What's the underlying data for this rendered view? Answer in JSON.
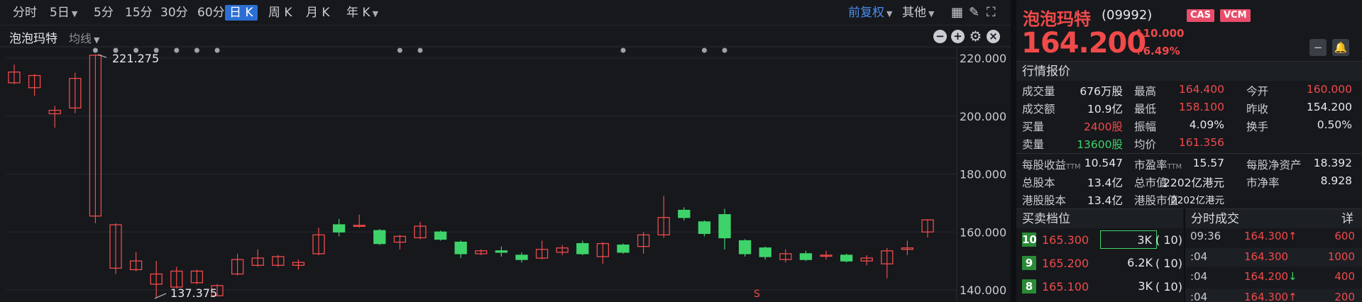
{
  "toolbar": {
    "periods": [
      {
        "label": "分时",
        "active": false,
        "has_menu": false
      },
      {
        "label": "5日",
        "active": false,
        "has_menu": true
      },
      {
        "label": "5分",
        "active": false,
        "has_menu": false
      },
      {
        "label": "15分",
        "active": false,
        "has_menu": false
      },
      {
        "label": "30分",
        "active": false,
        "has_menu": false
      },
      {
        "label": "60分",
        "active": false,
        "has_menu": false
      },
      {
        "label": "日 K",
        "active": true,
        "has_menu": false
      },
      {
        "label": "周 K",
        "active": false,
        "has_menu": false
      },
      {
        "label": "月 K",
        "active": false,
        "has_menu": false
      },
      {
        "label": "年 K",
        "active": false,
        "has_menu": true
      }
    ],
    "adjust_label": "前复权",
    "more_label": "其他",
    "icons": [
      "grid-layout-icon",
      "draw-pen-icon",
      "fullscreen-icon"
    ]
  },
  "chart_header": {
    "title": "泡泡玛特",
    "indicator_label": "均线",
    "controls": [
      "minus-icon",
      "plus-icon",
      "settings-icon",
      "close-icon"
    ]
  },
  "chart_data": {
    "type": "candlestick",
    "y_ticks": [
      "220.000",
      "200.000",
      "180.000",
      "160.000",
      "140.000"
    ],
    "ylim": [
      134,
      224
    ],
    "annotations": [
      {
        "label": "221.275",
        "kind": "high"
      },
      {
        "label": "137.375",
        "kind": "low"
      },
      {
        "label": "S",
        "kind": "marker"
      }
    ],
    "candles": [
      {
        "o": 211.5,
        "c": 215.2,
        "h": 217.8,
        "l": 211.0
      },
      {
        "o": 209.8,
        "c": 214.0,
        "h": 214.5,
        "l": 207.0
      },
      {
        "o": 200.8,
        "c": 202.0,
        "h": 203.5,
        "l": 196.0
      },
      {
        "o": 202.8,
        "c": 213.0,
        "h": 215.0,
        "l": 201.0
      },
      {
        "o": 165.5,
        "c": 221.0,
        "h": 221.3,
        "l": 163.0
      },
      {
        "o": 147.5,
        "c": 162.5,
        "h": 163.0,
        "l": 145.5
      },
      {
        "o": 147.0,
        "c": 150.0,
        "h": 153.0,
        "l": 146.5
      },
      {
        "o": 142.0,
        "c": 145.5,
        "h": 150.0,
        "l": 137.4
      },
      {
        "o": 141.0,
        "c": 146.5,
        "h": 148.0,
        "l": 140.5
      },
      {
        "o": 142.5,
        "c": 146.5,
        "h": 147.0,
        "l": 142.0
      },
      {
        "o": 138.0,
        "c": 141.5,
        "h": 142.0,
        "l": 137.8
      },
      {
        "o": 145.5,
        "c": 150.5,
        "h": 152.5,
        "l": 145.0
      },
      {
        "o": 148.5,
        "c": 151.0,
        "h": 154.0,
        "l": 148.0
      },
      {
        "o": 148.5,
        "c": 151.5,
        "h": 152.0,
        "l": 148.0
      },
      {
        "o": 148.5,
        "c": 149.5,
        "h": 150.5,
        "l": 147.0
      },
      {
        "o": 152.5,
        "c": 159.0,
        "h": 161.5,
        "l": 152.0
      },
      {
        "o": 162.5,
        "c": 160.0,
        "h": 164.5,
        "l": 158.5
      },
      {
        "o": 162.0,
        "c": 162.3,
        "h": 166.0,
        "l": 161.5
      },
      {
        "o": 160.5,
        "c": 156.0,
        "h": 161.0,
        "l": 155.5
      },
      {
        "o": 156.5,
        "c": 158.5,
        "h": 159.0,
        "l": 154.0
      },
      {
        "o": 158.0,
        "c": 162.0,
        "h": 163.5,
        "l": 157.5
      },
      {
        "o": 160.0,
        "c": 157.5,
        "h": 160.5,
        "l": 157.0
      },
      {
        "o": 156.5,
        "c": 152.5,
        "h": 157.0,
        "l": 151.0
      },
      {
        "o": 152.5,
        "c": 153.5,
        "h": 154.0,
        "l": 152.0
      },
      {
        "o": 153.5,
        "c": 153.0,
        "h": 155.0,
        "l": 151.5
      },
      {
        "o": 152.0,
        "c": 150.5,
        "h": 153.0,
        "l": 149.5
      },
      {
        "o": 151.0,
        "c": 154.0,
        "h": 157.0,
        "l": 150.5
      },
      {
        "o": 153.0,
        "c": 154.5,
        "h": 155.5,
        "l": 152.0
      },
      {
        "o": 156.0,
        "c": 152.5,
        "h": 157.0,
        "l": 152.0
      },
      {
        "o": 151.5,
        "c": 156.0,
        "h": 156.5,
        "l": 149.0
      },
      {
        "o": 155.5,
        "c": 153.0,
        "h": 156.0,
        "l": 152.5
      },
      {
        "o": 155.0,
        "c": 159.0,
        "h": 160.0,
        "l": 152.5
      },
      {
        "o": 159.0,
        "c": 165.0,
        "h": 172.5,
        "l": 158.0
      },
      {
        "o": 167.5,
        "c": 165.0,
        "h": 168.5,
        "l": 164.0
      },
      {
        "o": 163.5,
        "c": 159.5,
        "h": 164.0,
        "l": 158.5
      },
      {
        "o": 166.0,
        "c": 158.0,
        "h": 168.0,
        "l": 154.0
      },
      {
        "o": 157.0,
        "c": 152.5,
        "h": 157.5,
        "l": 151.5
      },
      {
        "o": 154.5,
        "c": 151.5,
        "h": 155.0,
        "l": 150.5
      },
      {
        "o": 150.5,
        "c": 152.5,
        "h": 154.0,
        "l": 149.5
      },
      {
        "o": 152.5,
        "c": 150.5,
        "h": 153.5,
        "l": 150.0
      },
      {
        "o": 152.0,
        "c": 152.0,
        "h": 153.5,
        "l": 150.5
      },
      {
        "o": 152.0,
        "c": 150.0,
        "h": 152.5,
        "l": 149.5
      },
      {
        "o": 150.0,
        "c": 151.0,
        "h": 152.0,
        "l": 148.5
      },
      {
        "o": 149.0,
        "c": 153.5,
        "h": 154.5,
        "l": 144.0
      },
      {
        "o": 154.0,
        "c": 154.5,
        "h": 157.0,
        "l": 152.0
      },
      {
        "o": 160.0,
        "c": 164.2,
        "h": 164.4,
        "l": 158.1
      }
    ],
    "dots": [
      4,
      5,
      6,
      7,
      8,
      9,
      10,
      19,
      20,
      30,
      34,
      35
    ],
    "up_color": "#f04a4a",
    "down_color": "#3ed36a"
  },
  "quote": {
    "name": "泡泡玛特",
    "code": "(09992)",
    "badges": [
      "CAS",
      "VCM"
    ],
    "price": "164.200",
    "change": "10.000",
    "change_pct": "+6.49%",
    "section_title": "行情报价",
    "grid": [
      [
        {
          "label": "成交量",
          "value": "676万股",
          "color": "white"
        },
        {
          "label": "最高",
          "value": "164.400",
          "color": "red"
        },
        {
          "label": "今开",
          "value": "160.000",
          "color": "red"
        }
      ],
      [
        {
          "label": "成交额",
          "value": "10.9亿",
          "color": "white"
        },
        {
          "label": "最低",
          "value": "158.100",
          "color": "red"
        },
        {
          "label": "昨收",
          "value": "154.200",
          "color": "white"
        }
      ],
      [
        {
          "label": "买量",
          "value": "2400股",
          "color": "red"
        },
        {
          "label": "振幅",
          "value": "4.09%",
          "color": "white"
        },
        {
          "label": "换手",
          "value": "0.50%",
          "color": "white"
        }
      ],
      [
        {
          "label": "卖量",
          "value": "13600股",
          "color": "green"
        },
        {
          "label": "均价",
          "value": "161.356",
          "color": "red"
        },
        {
          "label": "",
          "value": "",
          "color": "white"
        }
      ]
    ],
    "fundamentals": [
      [
        {
          "label": "每股收益",
          "sub": "TTM",
          "value": "10.547"
        },
        {
          "label": "市盈率",
          "sub": "TTM",
          "value": "15.57"
        },
        {
          "label": "每股净资产",
          "sub": "",
          "value": "18.392"
        }
      ],
      [
        {
          "label": "总股本",
          "sub": "",
          "value": "13.4亿"
        },
        {
          "label": "总市值",
          "sub": "",
          "value": "2202亿港元"
        },
        {
          "label": "市净率",
          "sub": "",
          "value": "8.928"
        }
      ],
      [
        {
          "label": "港股股本",
          "sub": "",
          "value": "13.4亿"
        },
        {
          "label": "港股市值",
          "sub": "",
          "value": "2202亿港元"
        },
        {
          "label": "",
          "sub": "",
          "value": ""
        }
      ]
    ]
  },
  "order_book": {
    "title": "买卖档位",
    "rows": [
      {
        "level": "10",
        "price": "165.300",
        "volume": "3K",
        "count": "(   10)",
        "highlight": true
      },
      {
        "level": "9",
        "price": "165.200",
        "volume": "6.2K",
        "count": "(   10)",
        "highlight": false
      },
      {
        "level": "8",
        "price": "165.100",
        "volume": "3K",
        "count": "(   10)",
        "highlight": false
      }
    ]
  },
  "ticks": {
    "title": "分时成交",
    "detail_label": "详",
    "rows": [
      {
        "time": "09:36",
        "price": "164.300",
        "dir": "up",
        "volume": "600"
      },
      {
        "time": ":04",
        "price": "164.300",
        "dir": "",
        "volume": "1000"
      },
      {
        "time": ":04",
        "price": "164.200",
        "dir": "down",
        "volume": "400"
      },
      {
        "time": ":04",
        "price": "164.300",
        "dir": "up",
        "volume": "200"
      }
    ]
  }
}
